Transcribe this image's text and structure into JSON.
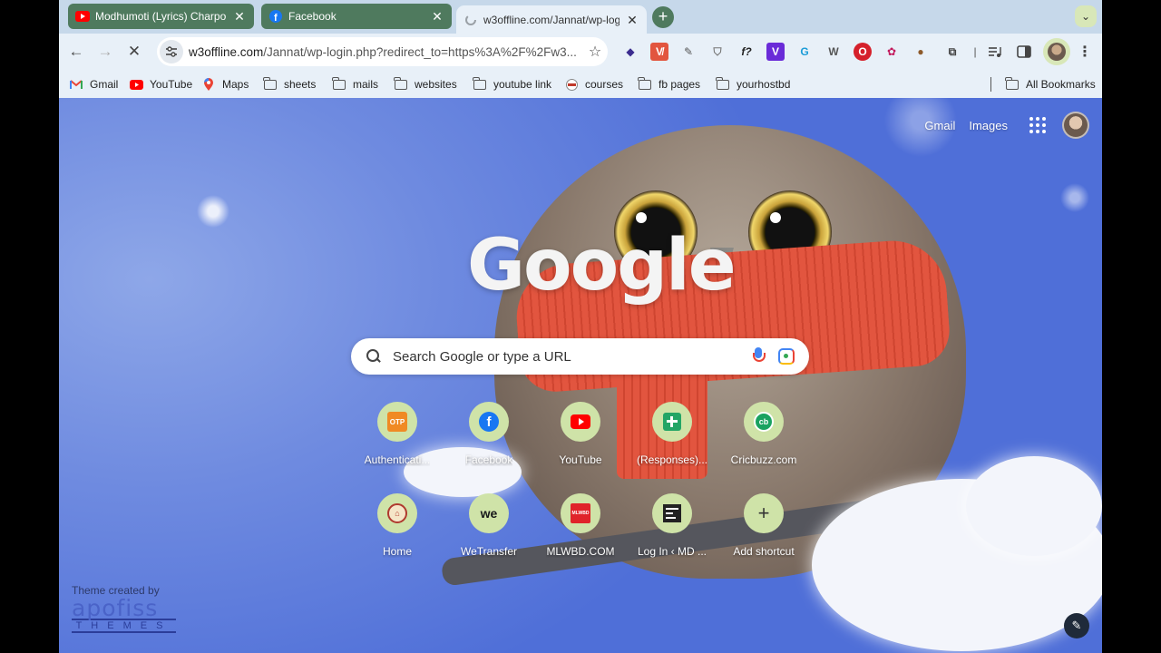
{
  "tabs": [
    {
      "title": "Modhumoti (Lyrics) Charpoka",
      "favicon": "youtube-icon",
      "state": "inactive"
    },
    {
      "title": "Facebook",
      "favicon": "facebook-icon",
      "state": "inactive"
    },
    {
      "title": "w3offline.com/Jannat/wp-log",
      "favicon": "loading-icon",
      "state": "active"
    }
  ],
  "new_tab": "+",
  "tab_search": "⌄",
  "toolbar": {
    "back": "←",
    "forward": "→",
    "stop": "✕",
    "url_host": "w3offline.com",
    "url_path": "/Jannat/wp-login.php?redirect_to=https%3A%2F%2Fw3...",
    "star": "☆",
    "extensions": [
      "◆",
      "V̸",
      "✎",
      "⛉",
      "f?",
      "V",
      "G",
      "W",
      "O",
      "✿",
      "●",
      "⧉"
    ],
    "menu": "⋮"
  },
  "bookmarks": [
    {
      "label": "Gmail",
      "icon": "gmail-icon"
    },
    {
      "label": "YouTube",
      "icon": "youtube-icon"
    },
    {
      "label": "Maps",
      "icon": "maps-icon"
    },
    {
      "label": "sheets",
      "icon": "folder-icon"
    },
    {
      "label": "mails",
      "icon": "folder-icon"
    },
    {
      "label": "websites",
      "icon": "folder-icon"
    },
    {
      "label": "youtube link",
      "icon": "folder-icon"
    },
    {
      "label": "courses",
      "icon": "courses-icon"
    },
    {
      "label": "fb pages",
      "icon": "folder-icon"
    },
    {
      "label": "yourhostbd",
      "icon": "folder-icon"
    },
    {
      "label": "All Bookmarks",
      "icon": "folder-icon"
    }
  ],
  "ntp": {
    "gmail": "Gmail",
    "images": "Images",
    "logo": "Google",
    "search_placeholder": "Search Google or type a URL",
    "shortcuts": [
      {
        "label": "Authenticati...",
        "icon": "auth-icon",
        "color": "#f08a24"
      },
      {
        "label": "Facebook",
        "icon": "facebook-icon",
        "color": "#1877f2"
      },
      {
        "label": "YouTube",
        "icon": "youtube-icon",
        "color": "#ff0000"
      },
      {
        "label": "(Responses)...",
        "icon": "sheets-icon",
        "color": "#23a566"
      },
      {
        "label": "Cricbuzz.com",
        "icon": "cricbuzz-icon",
        "color": "#1aa260"
      },
      {
        "label": "Home",
        "icon": "home-icon",
        "color": "#b03a2e"
      },
      {
        "label": "WeTransfer",
        "icon": "wetransfer-icon",
        "color": "#17181a"
      },
      {
        "label": "MLWBD.COM",
        "icon": "mlwbd-icon",
        "color": "#e0242a"
      },
      {
        "label": "Log In ‹ MD ...",
        "icon": "login-icon",
        "color": "#222222"
      },
      {
        "label": "Add shortcut",
        "icon": "plus-icon",
        "color": "#333333"
      }
    ],
    "theme_credit": "Theme created by",
    "theme_logo_big": "apofiss",
    "theme_logo_small": "THEMES",
    "customize": "✎"
  }
}
